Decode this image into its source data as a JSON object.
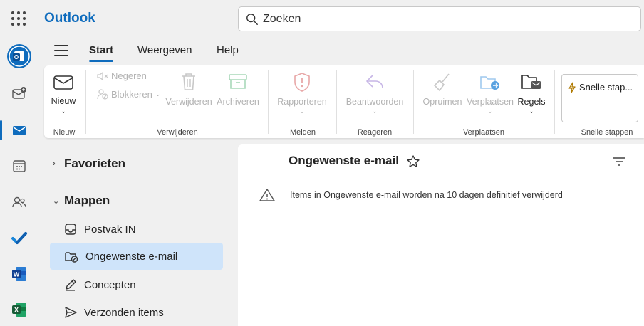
{
  "app": {
    "title": "Outlook"
  },
  "search": {
    "placeholder": "Zoeken"
  },
  "tabs": [
    {
      "label": "Start"
    },
    {
      "label": "Weergeven"
    },
    {
      "label": "Help"
    }
  ],
  "ribbon": {
    "new": {
      "label": "Nieuw",
      "group": "Nieuw"
    },
    "delete_group": {
      "group": "Verwijderen",
      "ignore": "Negeren",
      "block": "Blokkeren",
      "delete": "Verwijderen",
      "archive": "Archiveren"
    },
    "report_group": {
      "group": "Melden",
      "report": "Rapporteren"
    },
    "respond_group": {
      "group": "Reageren",
      "reply": "Beantwoorden"
    },
    "move_group": {
      "group": "Verplaatsen",
      "sweep": "Opruimen",
      "move": "Verplaatsen",
      "rules": "Regels"
    },
    "quick_group": {
      "group": "Snelle stappen",
      "quick": "Snelle stap..."
    }
  },
  "folders": {
    "favorites": "Favorieten",
    "mappen": "Mappen",
    "items": [
      {
        "label": "Postvak IN"
      },
      {
        "label": "Ongewenste e-mail"
      },
      {
        "label": "Concepten"
      },
      {
        "label": "Verzonden items"
      }
    ]
  },
  "maillist": {
    "title": "Ongewenste e-mail",
    "info": "Items in Ongewenste e-mail worden na 10 dagen definitief verwijderd"
  },
  "colors": {
    "accent": "#0f6cbd",
    "selected": "#cfe4fa"
  }
}
